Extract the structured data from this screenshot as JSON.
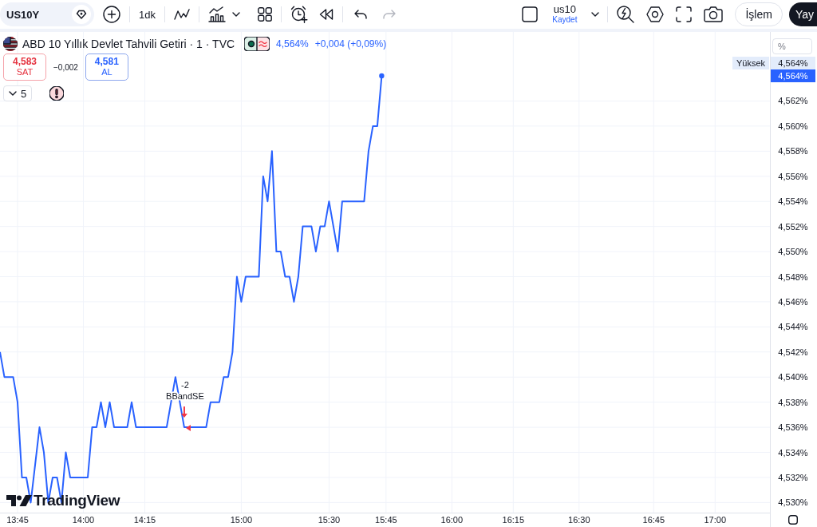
{
  "toolbar": {
    "symbol": "US10Y",
    "interval": "1dk",
    "history": [
      {
        "kind": "undo",
        "disabled": false
      },
      {
        "kind": "redo",
        "disabled": true
      }
    ],
    "layout": {
      "name": "us10",
      "action": "Kaydet"
    },
    "buttons": [
      {
        "kind": "outline",
        "label": "İşlem"
      },
      {
        "kind": "filled",
        "label": "Yay"
      }
    ]
  },
  "legend": {
    "title": "ABD 10 Yıllık Devlet Tahvili Getiri · 1 · TVC",
    "last": "4,564%",
    "change": "+0,004 (+0,09%)",
    "sell": {
      "price": "4,583",
      "label": "SAT"
    },
    "spread": "−0,002",
    "buy": {
      "price": "4,581",
      "label": "AL"
    },
    "indicators_toggle": "5"
  },
  "chart": {
    "chart_data": {
      "type": "line",
      "grid": true,
      "categories": [
        null,
        null,
        null,
        null,
        "13:45",
        null,
        null,
        null,
        null,
        null,
        null,
        null,
        null,
        null,
        null,
        null,
        null,
        null,
        null,
        "14:00",
        null,
        null,
        null,
        null,
        null,
        null,
        null,
        null,
        null,
        null,
        null,
        null,
        null,
        "14:15",
        null,
        null,
        null,
        null,
        null,
        null,
        null,
        null,
        null,
        null,
        null,
        null,
        null,
        null,
        null,
        null,
        null,
        null,
        null,
        null,
        null,
        "15:00",
        null,
        null,
        null,
        null,
        null,
        null,
        null,
        null,
        null,
        null,
        null,
        null,
        null,
        null,
        null,
        null,
        null,
        null,
        null,
        "15:30",
        null,
        null,
        null,
        null,
        null,
        null,
        null,
        null,
        null,
        null,
        null,
        null,
        "15:45",
        null,
        null,
        null,
        null,
        null,
        null,
        null,
        null,
        null,
        null,
        null,
        null,
        null,
        null,
        "16:00",
        null,
        null,
        null,
        null,
        null,
        null,
        null,
        null,
        null,
        null,
        null,
        null,
        null,
        "16:15",
        null,
        null,
        null,
        null,
        null,
        null,
        null,
        null,
        null,
        null,
        null,
        null,
        null,
        null,
        "16:30",
        null,
        null,
        null,
        null,
        null,
        null,
        null,
        null,
        null,
        null,
        null,
        null,
        null,
        null,
        null,
        null,
        "16:45",
        null,
        null,
        null,
        null,
        null,
        null,
        null,
        null,
        null,
        null,
        null,
        null,
        null,
        "17:00",
        null,
        null,
        null,
        null,
        null,
        null,
        null,
        null,
        null,
        null,
        null,
        null
      ],
      "series": [
        {
          "color": "#2962ff",
          "values": [
            4.542,
            4.54,
            4.54,
            4.54,
            4.538,
            4.532,
            4.532,
            4.53,
            4.533,
            4.536,
            4.534,
            4.53,
            4.532,
            4.532,
            4.53,
            4.534,
            4.532,
            4.532,
            4.532,
            4.532,
            4.532,
            4.536,
            4.536,
            4.538,
            4.536,
            4.538,
            4.536,
            4.536,
            4.536,
            4.536,
            4.538,
            4.536,
            4.536,
            4.536,
            4.536,
            4.536,
            4.536,
            4.536,
            4.536,
            4.538,
            4.54,
            4.538,
            4.536,
            4.536,
            4.536,
            4.536,
            4.536,
            4.536,
            4.538,
            4.538,
            4.538,
            4.54,
            4.54,
            4.542,
            4.548,
            4.546,
            4.548,
            4.548,
            4.548,
            4.548,
            4.556,
            4.554,
            4.558,
            4.55,
            4.55,
            4.548,
            4.548,
            4.546,
            4.548,
            4.552,
            4.552,
            4.552,
            4.55,
            4.552,
            4.552,
            4.554,
            4.552,
            4.55,
            4.554,
            4.554,
            4.554,
            4.554,
            4.554,
            4.554,
            4.558,
            4.56,
            4.56,
            4.564,
            null,
            null,
            null,
            null,
            null,
            null,
            null,
            null,
            null,
            null,
            null,
            null,
            null,
            null,
            null,
            null,
            null,
            null,
            null,
            null,
            null,
            null,
            null,
            null,
            null,
            null,
            null,
            null,
            null,
            null,
            null,
            null,
            null,
            null,
            null,
            null,
            null,
            null,
            null,
            null,
            null,
            null,
            null,
            null,
            null,
            null,
            null,
            null,
            null,
            null,
            null,
            null,
            null,
            null,
            null,
            null,
            null,
            null,
            null,
            null,
            null,
            null,
            null,
            null,
            null,
            null,
            null,
            null,
            null,
            null,
            null,
            null,
            null,
            null,
            null,
            null,
            null,
            null,
            null,
            null,
            null,
            null,
            null,
            null,
            null,
            null,
            null,
            null
          ]
        }
      ],
      "ylim": [
        4.5292,
        4.5675
      ],
      "yticks": [
        {
          "value": 4.562,
          "label": "4,562%"
        },
        {
          "value": 4.56,
          "label": "4,560%"
        },
        {
          "value": 4.558,
          "label": "4,558%"
        },
        {
          "value": 4.556,
          "label": "4,556%"
        },
        {
          "value": 4.554,
          "label": "4,554%"
        },
        {
          "value": 4.552,
          "label": "4,552%"
        },
        {
          "value": 4.55,
          "label": "4,550%"
        },
        {
          "value": 4.548,
          "label": "4,548%"
        },
        {
          "value": 4.546,
          "label": "4,546%"
        },
        {
          "value": 4.544,
          "label": "4,544%"
        },
        {
          "value": 4.542,
          "label": "4,542%"
        },
        {
          "value": 4.54,
          "label": "4,540%"
        },
        {
          "value": 4.538,
          "label": "4,538%"
        },
        {
          "value": 4.536,
          "label": "4,536%"
        },
        {
          "value": 4.534,
          "label": "4,534%"
        },
        {
          "value": 4.532,
          "label": "4,532%"
        },
        {
          "value": 4.53,
          "label": "4,530%"
        }
      ],
      "annotations": [
        "-2",
        "BBandSE"
      ]
    }
  },
  "price_axis": {
    "unit": "%",
    "high": {
      "label": "Yüksek",
      "value": "4,564%"
    },
    "last_price": "4,564%"
  },
  "logo": {
    "text": "TradingView"
  }
}
